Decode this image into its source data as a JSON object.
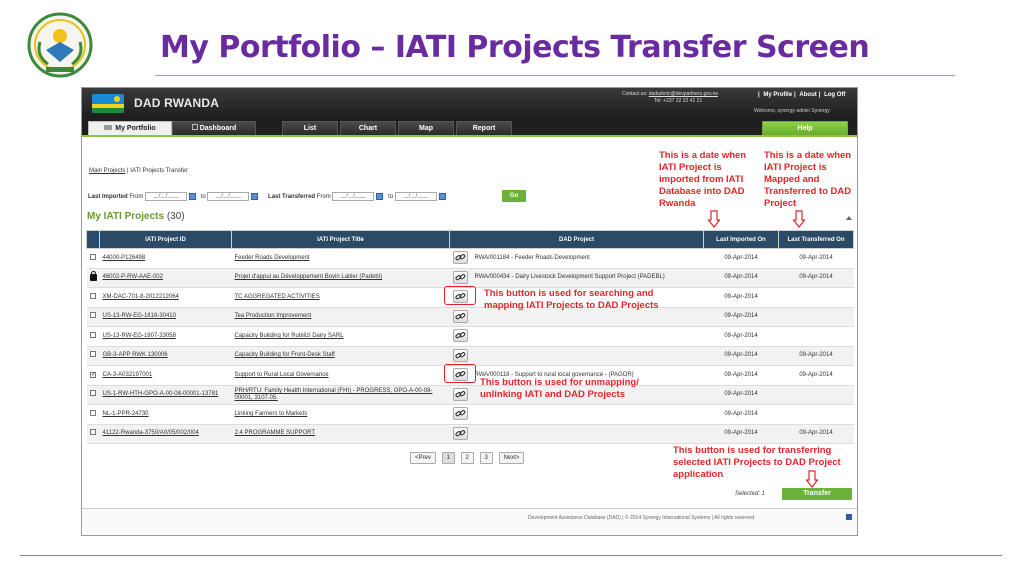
{
  "slide": {
    "title": "My Portfolio – IATI Projects Transfer Screen"
  },
  "app": {
    "name": "DAD RWANDA",
    "contact_label": "Contact us:",
    "contact_email": "dadadmin@devpartners.gov.rw",
    "contact_phone": "Tel: +237 22 22 41 21",
    "top_links": [
      "My Profile",
      "About",
      "Log Off"
    ],
    "welcome": "Welcome, synergy admin Synergy",
    "tabs": [
      {
        "label": "My Portfolio",
        "active": true
      },
      {
        "label": "Dashboard",
        "active": false
      },
      {
        "label": "List",
        "active": false
      },
      {
        "label": "Chart",
        "active": false
      },
      {
        "label": "Map",
        "active": false
      },
      {
        "label": "Report",
        "active": false
      },
      {
        "label": "Help",
        "active": false
      }
    ],
    "breadcrumb": {
      "root": "Main Projects",
      "sep": "|",
      "current": "IATI Projects Transfer"
    },
    "filter": {
      "last_imported_label": "Last Imported",
      "from_label": "From",
      "to_label": "to",
      "last_transferred_label": "Last Transferred",
      "date_placeholder": "__/__/____",
      "go_label": "Go"
    },
    "section": {
      "title": "My IATI Projects",
      "count": "(30)"
    },
    "columns": [
      "IATI Project ID",
      "IATI Project Title",
      "DAD Project",
      "Last Imported On",
      "Last Transferred On"
    ],
    "rows": [
      {
        "check": "",
        "id": "44000-P126498",
        "title": "Feeder Roads Development",
        "dad": "RWA/001184 - Feeder Roads Development",
        "imported": "09-Apr-2014",
        "transferred": "09-Apr-2014"
      },
      {
        "check": "lock",
        "id": "46002-P-RW-AAE-002",
        "title": "Projet d'appui au Développement Bovin Laitier (Padebl)",
        "dad": "RWA/000434 - Dairy Livestock Development Support Project (PADEBL)",
        "imported": "09-Apr-2014",
        "transferred": "09-Apr-2014"
      },
      {
        "check": "",
        "id": "XM-DAC-701-8-2012212064",
        "title": "TC AGGREGATED ACTIVITIES",
        "dad": "",
        "imported": "09-Apr-2014",
        "transferred": ""
      },
      {
        "check": "",
        "id": "US-13-RW-EG-1818-30410",
        "title": "Tea Production Improvement",
        "dad": "",
        "imported": "09-Apr-2014",
        "transferred": ""
      },
      {
        "check": "",
        "id": "US-13-RW-EG-1807-33058",
        "title": "Capacity Building for Rubilizi Dairy SARL",
        "dad": "",
        "imported": "09-Apr-2014",
        "transferred": ""
      },
      {
        "check": "",
        "id": "GB-3-APP RWK 130006",
        "title": "Capacity Building for Front-Desk Staff",
        "dad": "",
        "imported": "09-Apr-2014",
        "transferred": "09-Apr-2014"
      },
      {
        "check": "checked",
        "id": "CA-3-A032197001",
        "title": "Support to Rural Local Governance",
        "dad": "RWA/000118 - Support to rural local governance - (PAGOR)",
        "imported": "09-Apr-2014",
        "transferred": "09-Apr-2014"
      },
      {
        "check": "",
        "id": "US-1-RW-HTH-GPO-A-00-08-00001-13781",
        "title": "PRH/RTU: Family Health International (FHI) - PROGRESS, GPO-A-00-08-00001, 3107.05.",
        "dad": "",
        "imported": "09-Apr-2014",
        "transferred": ""
      },
      {
        "check": "",
        "id": "NL-1-PPR-24730",
        "title": "Linking Farmers to Markets",
        "dad": "",
        "imported": "09-Apr-2014",
        "transferred": ""
      },
      {
        "check": "",
        "id": "41122-Rwanda-3750/A0/05/002/004",
        "title": "2.4 PROGRAMME SUPPORT",
        "dad": "",
        "imported": "09-Apr-2014",
        "transferred": "09-Apr-2014"
      }
    ],
    "pager": [
      "<Prev",
      "1",
      "2",
      "3",
      "Next>"
    ],
    "selected_label": "Selected: 1",
    "transfer_label": "Transfer",
    "footer": "Development Assistance Database (DAD) | © 2014 Synergy International Systems | All rights reserved"
  },
  "annotations": {
    "imported_note": "This is a date when IATI Project is imported from IATI Database into DAD Rwanda",
    "transferred_note": "This is a date when IATI Project is Mapped and Transferred to DAD Project",
    "map_note": "This button is used for searching and mapping IATI Projects to DAD Projects",
    "unmap_note": "This button is used for unmapping/ unlinking IATI and DAD Projects",
    "transfer_note": "This button is used for transferring selected IATI Projects to DAD Project application"
  },
  "colors": {
    "title": "#6a2ba0",
    "accent_green": "#6ab23a",
    "header_dark": "#2b4a66",
    "annotation_red": "#e0262a"
  }
}
